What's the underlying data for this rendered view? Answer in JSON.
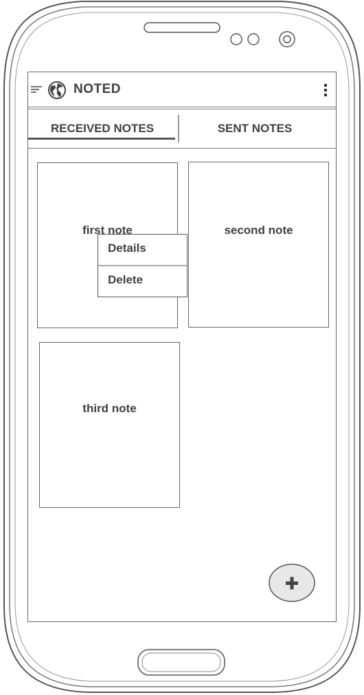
{
  "app_bar": {
    "title": "NOTED",
    "menu_icon": "hamburger-icon",
    "logo_icon": "globe-icon",
    "overflow_icon": "more-vertical-icon"
  },
  "tabs": [
    {
      "label": "RECEIVED NOTES",
      "selected": true
    },
    {
      "label": "SENT NOTES",
      "selected": false
    }
  ],
  "notes": [
    {
      "title": "first note"
    },
    {
      "title": "second note"
    },
    {
      "title": "third note"
    }
  ],
  "context_menu": {
    "items": [
      {
        "label": "Details"
      },
      {
        "label": "Delete"
      }
    ]
  },
  "fab": {
    "icon": "plus-icon"
  },
  "colors": {
    "text": "#3f3f3f",
    "outline": "#666666",
    "fab_fill": "#e8e8e8"
  }
}
